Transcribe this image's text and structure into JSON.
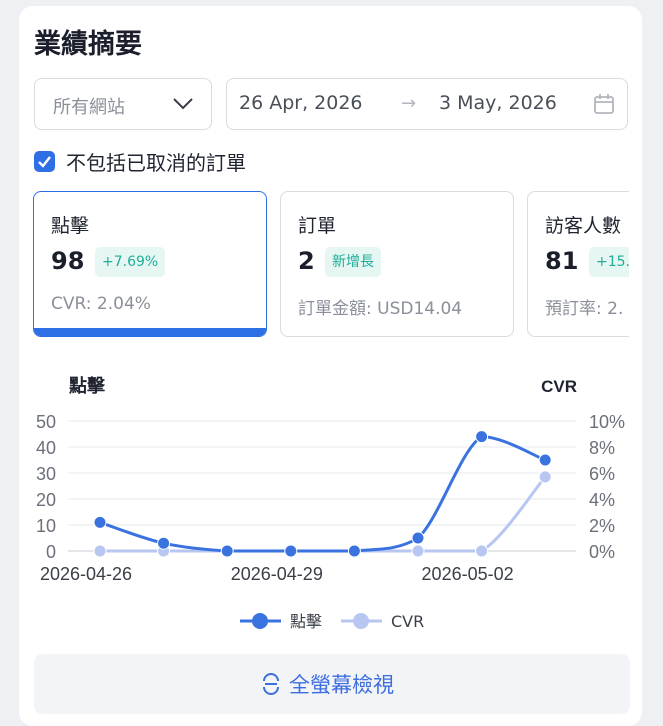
{
  "page": {
    "title": "業績摘要"
  },
  "filters": {
    "site_select": "所有網站",
    "date_start": "26 Apr, 2026",
    "date_arrow": "→",
    "date_end": "3 May, 2026",
    "exclude_cancelled_label": "不包括已取消的訂單",
    "exclude_cancelled_checked": true
  },
  "tiles": [
    {
      "label": "點擊",
      "value": "98",
      "badge": "+7.69%",
      "sub": "CVR: 2.04%",
      "active": true
    },
    {
      "label": "訂單",
      "value": "2",
      "badge": "新增長",
      "sub": "訂單金額: USD14.04",
      "active": false
    },
    {
      "label": "訪客人數",
      "value": "81",
      "badge": "+15.",
      "sub": "預訂率: 2.",
      "active": false
    }
  ],
  "chart_data": {
    "type": "line",
    "x": [
      "2026-04-26",
      "2026-04-27",
      "2026-04-28",
      "2026-04-29",
      "2026-04-30",
      "2026-05-01",
      "2026-05-02",
      "2026-05-03"
    ],
    "x_tick_labels": [
      "2026-04-26",
      "2026-04-29",
      "2026-05-02"
    ],
    "y_left_label": "點擊",
    "y_right_label": "CVR",
    "y_left_ticks": [
      "0",
      "10",
      "20",
      "30",
      "40",
      "50"
    ],
    "y_right_ticks": [
      "0%",
      "2%",
      "4%",
      "6%",
      "8%",
      "10%"
    ],
    "ylim_left": [
      0,
      50
    ],
    "ylim_right": [
      0,
      10
    ],
    "series": [
      {
        "name": "點擊",
        "axis": "left",
        "color": "#3a72e0",
        "values": [
          11,
          3,
          0,
          0,
          0,
          5,
          44,
          35
        ]
      },
      {
        "name": "CVR",
        "axis": "right",
        "color": "#b8c6f2",
        "values": [
          0,
          0,
          0,
          0,
          0,
          0,
          0,
          5.7
        ]
      }
    ],
    "legend_position": "bottom",
    "grid": true
  },
  "fullscreen_button": {
    "label": "全螢幕檢視",
    "icon": "fullscreen-icon"
  }
}
